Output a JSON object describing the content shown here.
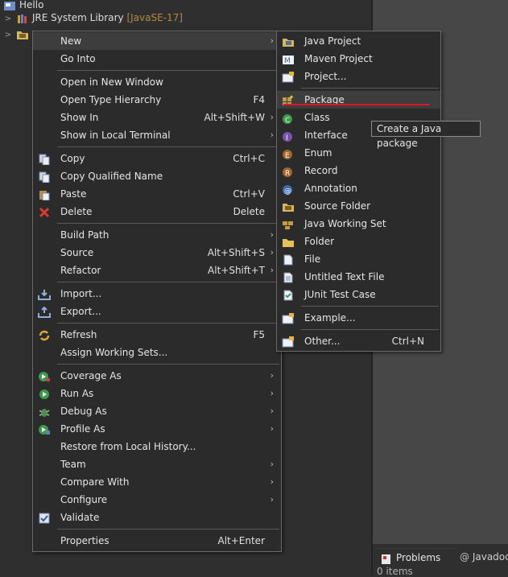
{
  "tree": {
    "hello_label": "Hello",
    "jre_label": "JRE System Library",
    "jre_version": "[JavaSE-17]"
  },
  "context_menu": {
    "items": [
      {
        "label": "New",
        "accel": "",
        "arrow": "›"
      },
      {
        "label": "Go Into",
        "accel": ""
      },
      {
        "label": "Open in New Window",
        "accel": ""
      },
      {
        "label": "Open Type Hierarchy",
        "accel": "F4"
      },
      {
        "label": "Show In",
        "accel": "Alt+Shift+W",
        "arrow": "›"
      },
      {
        "label": "Show in Local Terminal",
        "accel": "",
        "arrow": "›"
      },
      {
        "label": "Copy",
        "accel": "Ctrl+C"
      },
      {
        "label": "Copy Qualified Name",
        "accel": ""
      },
      {
        "label": "Paste",
        "accel": "Ctrl+V"
      },
      {
        "label": "Delete",
        "accel": "Delete"
      },
      {
        "label": "Build Path",
        "accel": "",
        "arrow": "›"
      },
      {
        "label": "Source",
        "accel": "Alt+Shift+S",
        "arrow": "›"
      },
      {
        "label": "Refactor",
        "accel": "Alt+Shift+T",
        "arrow": "›"
      },
      {
        "label": "Import...",
        "accel": ""
      },
      {
        "label": "Export...",
        "accel": ""
      },
      {
        "label": "Refresh",
        "accel": "F5"
      },
      {
        "label": "Assign Working Sets...",
        "accel": ""
      },
      {
        "label": "Coverage As",
        "accel": "",
        "arrow": "›"
      },
      {
        "label": "Run As",
        "accel": "",
        "arrow": "›"
      },
      {
        "label": "Debug As",
        "accel": "",
        "arrow": "›"
      },
      {
        "label": "Profile As",
        "accel": "",
        "arrow": "›"
      },
      {
        "label": "Restore from Local History...",
        "accel": ""
      },
      {
        "label": "Team",
        "accel": "",
        "arrow": "›"
      },
      {
        "label": "Compare With",
        "accel": "",
        "arrow": "›"
      },
      {
        "label": "Configure",
        "accel": "",
        "arrow": "›"
      },
      {
        "label": "Validate",
        "accel": ""
      },
      {
        "label": "Properties",
        "accel": "Alt+Enter"
      }
    ]
  },
  "new_submenu": {
    "items": [
      {
        "label": "Java Project"
      },
      {
        "label": "Maven Project"
      },
      {
        "label": "Project..."
      },
      {
        "label": "Package"
      },
      {
        "label": "Class"
      },
      {
        "label": "Interface"
      },
      {
        "label": "Enum"
      },
      {
        "label": "Record"
      },
      {
        "label": "Annotation"
      },
      {
        "label": "Source Folder"
      },
      {
        "label": "Java Working Set"
      },
      {
        "label": "Folder"
      },
      {
        "label": "File"
      },
      {
        "label": "Untitled Text File"
      },
      {
        "label": "JUnit Test Case"
      },
      {
        "label": "Example..."
      },
      {
        "label": "Other...",
        "accel": "Ctrl+N"
      }
    ]
  },
  "tooltip": "Create a Java package",
  "bottom": {
    "problems_tab": "Problems",
    "javadoc_tab": "Javadoc",
    "items_count": "0 items"
  },
  "colors": {
    "accent_underline": "#e0152a",
    "menu_bg": "#2b2b2b"
  }
}
